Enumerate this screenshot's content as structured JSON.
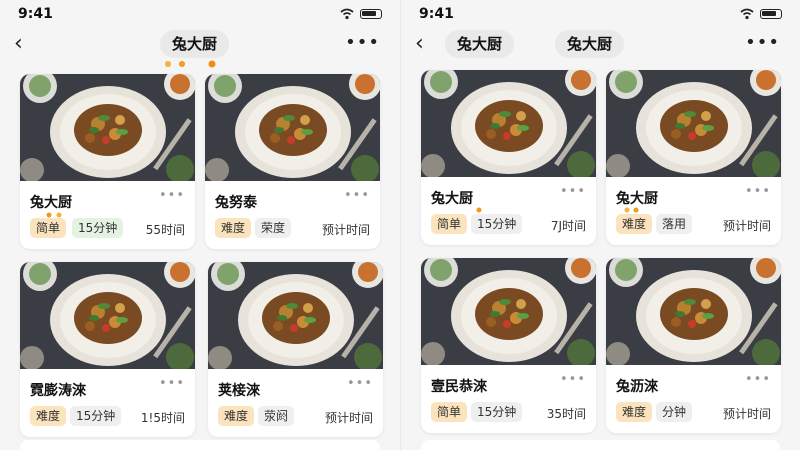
{
  "left": {
    "status": {
      "time": "9:41"
    },
    "nav": {
      "back": "‹",
      "pill": "兔大厨",
      "more": "•••"
    },
    "cards": [
      {
        "title": "兔大厨",
        "tag1": "简单",
        "tag2": "15分钟",
        "meta": "55时间"
      },
      {
        "title": "兔努泰",
        "tag1": "难度",
        "tag2": "荣度",
        "meta": "预计时间"
      },
      {
        "title": "霓膨涛淶",
        "tag1": "难度",
        "tag2": "15分钟",
        "meta": "1!5时间"
      },
      {
        "title": "荚椄淶",
        "tag1": "难度",
        "tag2": "荥阏",
        "meta": "预计时间"
      }
    ]
  },
  "right": {
    "status": {
      "time": "9:41"
    },
    "nav": {
      "back": "‹",
      "pill1": "兔大厨",
      "pill2": "兔大厨",
      "more": "•••"
    },
    "cards": [
      {
        "title": "兔大厨",
        "tag1": "简单",
        "tag2": "15分钟",
        "meta": "7J时间"
      },
      {
        "title": "兔大厨",
        "tag1": "难度",
        "tag2": "落用",
        "meta": "预计时间"
      },
      {
        "title": "壹民恭淶",
        "tag1": "简单",
        "tag2": "15分钟",
        "meta": "35时间"
      },
      {
        "title": "兔沥淶",
        "tag1": "难度",
        "tag2": "分钟",
        "meta": "预计时间"
      }
    ]
  },
  "colors": {
    "accent_orange": "#fbe3bd",
    "accent_green": "#e4f2e1",
    "tag_grey": "#efefef",
    "dot_orange": "#f39a1a"
  },
  "icons": {
    "back": "chevron-left-icon",
    "more": "more-dots-icon",
    "wifi": "wifi-icon",
    "battery": "battery-icon"
  }
}
